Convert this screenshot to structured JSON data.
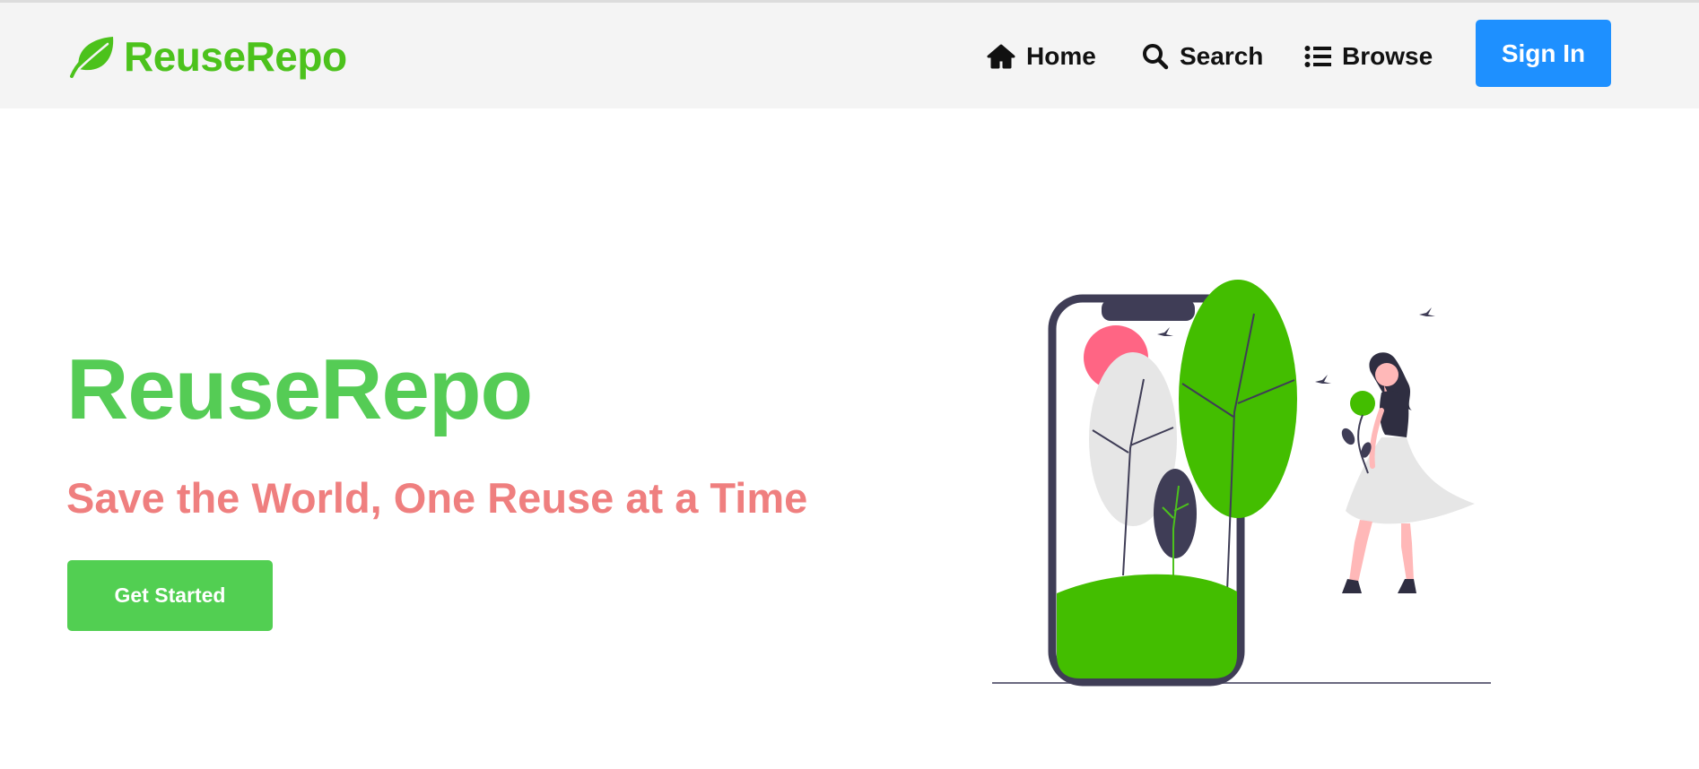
{
  "nav": {
    "brand": "ReuseRepo",
    "links": [
      {
        "label": "Home",
        "icon": "home-icon"
      },
      {
        "label": "Search",
        "icon": "search-icon"
      },
      {
        "label": "Browse",
        "icon": "list-icon"
      }
    ],
    "signin_label": "Sign In"
  },
  "hero": {
    "title": "ReuseRepo",
    "subtitle": "Save the World, One Reuse at a Time",
    "cta_label": "Get Started"
  },
  "colors": {
    "brand_green": "#4cc21c",
    "title_green": "#55cc55",
    "subtitle_pink": "#ef7f7f",
    "signin_blue": "#1e90ff",
    "cta_green": "#52cf52",
    "navbar_bg": "#f4f4f4"
  }
}
